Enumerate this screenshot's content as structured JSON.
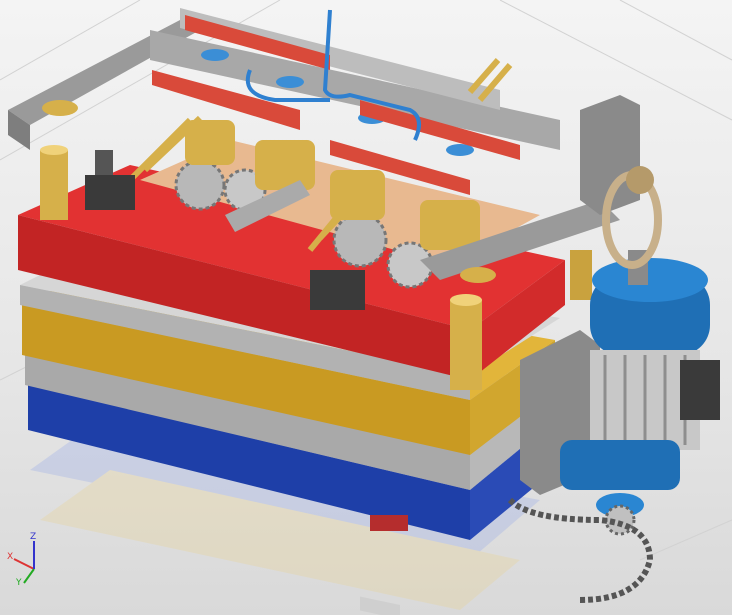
{
  "viewport": {
    "title": "",
    "background": "#e8e8e8"
  },
  "model": {
    "colors": {
      "red_plate": "#e23232",
      "gold_plate": "#d9a930",
      "gray_plate": "#bdbdbd",
      "blue_plate": "#2f55c7",
      "motor_blue": "#1f6fb5",
      "brass": "#d6b04a",
      "frame_gray": "#9a9a9a",
      "tan_plate": "#e8b990"
    },
    "parts": [
      {
        "name": "top-clamp-frame"
      },
      {
        "name": "gear-train"
      },
      {
        "name": "drive-motor"
      },
      {
        "name": "lifting-eye"
      },
      {
        "name": "roller-chain"
      },
      {
        "name": "guide-pillars"
      },
      {
        "name": "cooling-line"
      }
    ]
  },
  "triad": {
    "x_label": "X",
    "y_label": "Y",
    "z_label": "Z",
    "x_color": "#d33",
    "y_color": "#2a2",
    "z_color": "#33c"
  }
}
